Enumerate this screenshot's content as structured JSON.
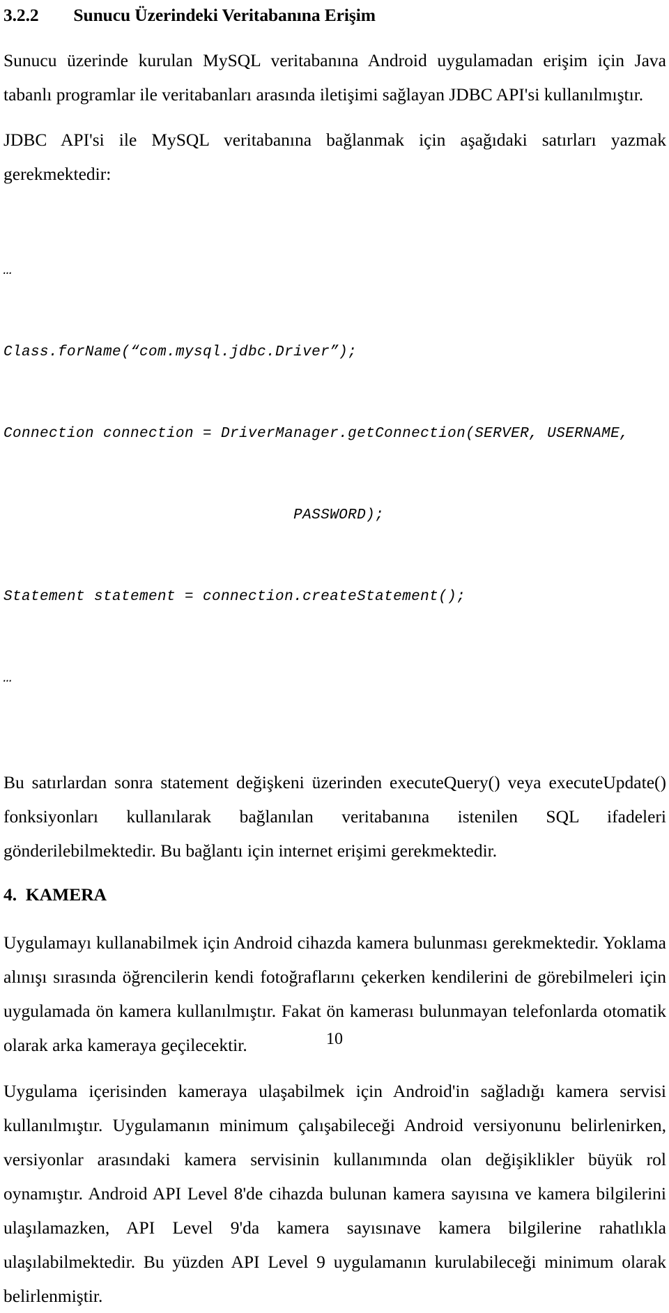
{
  "document": {
    "page_number": "10",
    "heading_section": {
      "number": "3.2.2",
      "title": "Sunucu Üzerindeki Veritabanına Erişim",
      "full": "3.2.2\tSunucu Üzerindeki Veritabanına Erişim"
    },
    "heading_chapter": {
      "number": "4.",
      "title": "KAMERA",
      "full": "4.  KAMERA"
    },
    "paragraphs": {
      "p1": "Sunucu üzerinde kurulan MySQL veritabanına Android uygulamadan erişim için Java tabanlı programlar ile veritabanları arasında iletişimi sağlayan JDBC API'si kullanılmıştır.",
      "p2": "JDBC API'si ile MySQL veritabanına bağlanmak için aşağıdaki satırları yazmak gerekmektedir:",
      "p3": "Bu satırlardan sonra statement değişkeni üzerinden executeQuery() veya executeUpdate() fonksiyonları kullanılarak bağlanılan veritabanına istenilen SQL ifadeleri gönderilebilmektedir. Bu bağlantı için internet erişimi gerekmektedir.",
      "p4": "Uygulamayı kullanabilmek için Android cihazda kamera bulunması gerekmektedir. Yoklama alınışı sırasında öğrencilerin kendi fotoğraflarını çekerken kendilerini de görebilmeleri için uygulamada ön kamera kullanılmıştır. Fakat ön kamerası bulunmayan telefonlarda otomatik olarak arka kameraya geçilecektir.",
      "p5": "Uygulama içerisinden kameraya ulaşabilmek için Android'in sağladığı kamera servisi kullanılmıştır. Uygulamanın minimum çalışabileceği Android versiyonunu belirlenirken, versiyonlar arasındaki kamera servisinin kullanımında olan değişiklikler büyük rol oynamıştır. Android API Level 8'de cihazda bulunan kamera sayısına ve kamera bilgilerini ulaşılamazken, API Level 9'da kamera sayısınave kamera bilgilerine rahatlıkla ulaşılabilmektedir. Bu yüzden API Level 9 uygulamanın kurulabileceği minimum olarak belirlenmiştir."
    },
    "code_snippet": {
      "ellipsis_top": "…",
      "line1": "Class.forName(“com.mysql.jdbc.Driver”);",
      "line2": "Connection connection = DriverManager.getConnection(SERVER, USERNAME,",
      "line3": "                                PASSWORD);",
      "line4": "Statement statement = connection.createStatement();",
      "ellipsis_bottom": "…"
    }
  }
}
